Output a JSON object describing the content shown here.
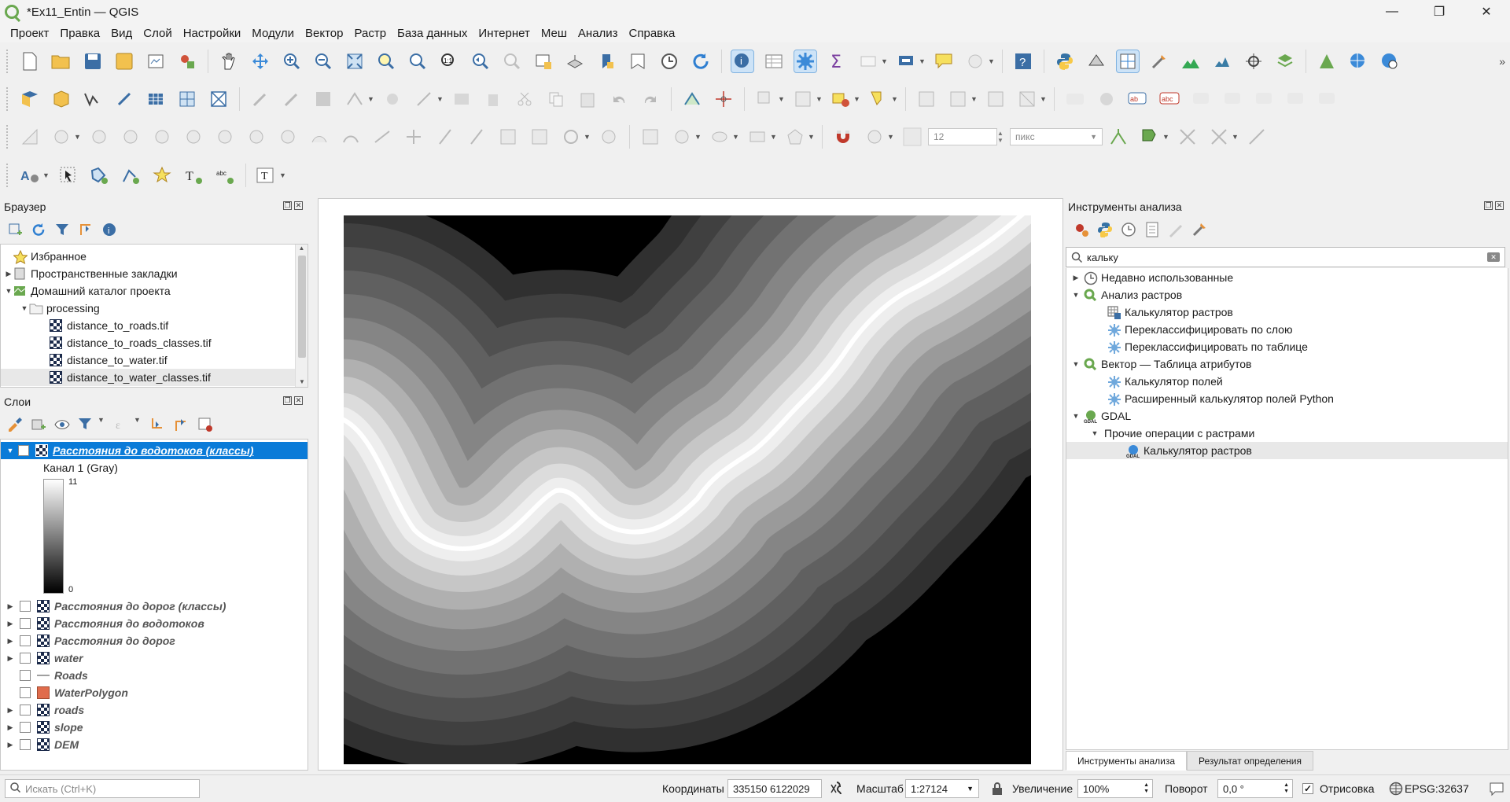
{
  "window": {
    "title": "*Ex11_Entin — QGIS",
    "minimize": "—",
    "restore": "❐",
    "close": "✕"
  },
  "menu": [
    "Проект",
    "Правка",
    "Вид",
    "Слой",
    "Настройки",
    "Модули",
    "Вектор",
    "Растр",
    "База данных",
    "Интернет",
    "Меш",
    "Анализ",
    "Справка"
  ],
  "toolbar": {
    "snap_tolerance": "12",
    "snap_units": "пикс"
  },
  "browser": {
    "title": "Браузер",
    "items": [
      {
        "label": "Избранное"
      },
      {
        "label": "Пространственные закладки"
      },
      {
        "label": "Домашний каталог проекта"
      },
      {
        "label": "processing"
      },
      {
        "label": "distance_to_roads.tif"
      },
      {
        "label": "distance_to_roads_classes.tif"
      },
      {
        "label": "distance_to_water.tif"
      },
      {
        "label": "distance_to_water_classes.tif"
      }
    ]
  },
  "layers": {
    "title": "Слои",
    "active": {
      "name": "Расстояния до водотоков (классы)",
      "band": "Канал 1 (Gray)",
      "max": "11",
      "min": "0"
    },
    "items": [
      {
        "name": "Расстояния до дорог (классы)"
      },
      {
        "name": "Расстояния до водотоков"
      },
      {
        "name": "Расстояния до дорог"
      },
      {
        "name": "water"
      },
      {
        "name": "Roads"
      },
      {
        "name": "WaterPolygon"
      },
      {
        "name": "roads"
      },
      {
        "name": "slope"
      },
      {
        "name": "DEM"
      }
    ]
  },
  "processing": {
    "title": "Инструменты анализа",
    "search": "кальку",
    "tree": [
      {
        "label": "Недавно использованные"
      },
      {
        "label": "Анализ растров"
      },
      {
        "label": "Калькулятор растров"
      },
      {
        "label": "Переклассифицировать по слою"
      },
      {
        "label": "Переклассифицировать по таблице"
      },
      {
        "label": "Вектор — Таблица атрибутов"
      },
      {
        "label": "Калькулятор полей"
      },
      {
        "label": "Расширенный калькулятор полей Python"
      },
      {
        "label": "GDAL"
      },
      {
        "label": "Прочие операции с растрами"
      },
      {
        "label": "Калькулятор растров"
      }
    ],
    "tabs": [
      "Инструменты анализа",
      "Результат определения"
    ]
  },
  "statusbar": {
    "search_placeholder": "Искать (Ctrl+K)",
    "coords_label": "Координаты",
    "coords_value": "335150  6122029",
    "scale_label": "Масштаб",
    "scale_value": "1:27124",
    "zoom_label": "Увеличение",
    "zoom_value": "100%",
    "rotation_label": "Поворот",
    "rotation_value": "0,0 °",
    "render_label": "Отрисовка",
    "crs": "EPSG:32637"
  },
  "colors": {
    "accent": "#0a7bd8",
    "qgis_green": "#6aa84f",
    "selection": "#0a7bd8"
  }
}
